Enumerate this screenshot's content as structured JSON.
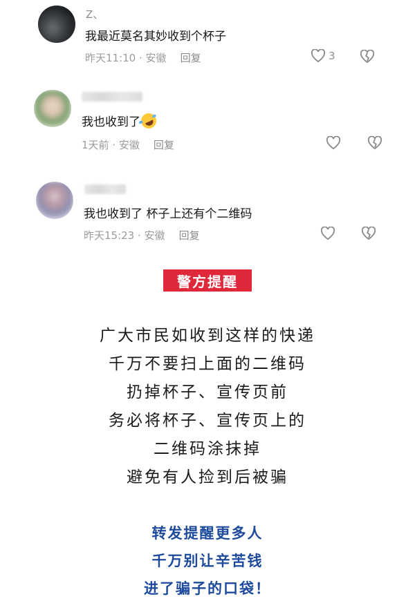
{
  "comments": [
    {
      "username": "Z、",
      "text": "我最近莫名其妙收到个杯子",
      "time": "昨天11:10",
      "location": "安徽",
      "reply_label": "回复",
      "likes": "3"
    },
    {
      "username": "",
      "text": "我也收到了",
      "emoji": "rolling-on-floor-laughing",
      "time": "1天前",
      "location": "安徽",
      "reply_label": "回复",
      "likes": ""
    },
    {
      "username": "",
      "text": "我也收到了 杯子上还有个二维码",
      "time": "昨天15:23",
      "location": "安徽",
      "reply_label": "回复",
      "likes": ""
    }
  ],
  "meta_separator": " · ",
  "warning": {
    "badge": "警方提醒",
    "badge_color": "#e0283b",
    "lines": [
      "广大市民如收到这样的快递",
      "千万不要扫上面的二维码",
      "扔掉杯子、宣传页前",
      "务必将杯子、宣传页上的",
      "二维码涂抹掉",
      "避免有人捡到后被骗"
    ]
  },
  "call_to_action": {
    "color": "#1d4a9c",
    "lines": [
      "转发提醒更多人",
      "千万别让辛苦钱",
      "进了骗子的口袋！"
    ]
  },
  "icons": {
    "like": "heart-outline-icon",
    "dislike": "broken-heart-icon"
  }
}
